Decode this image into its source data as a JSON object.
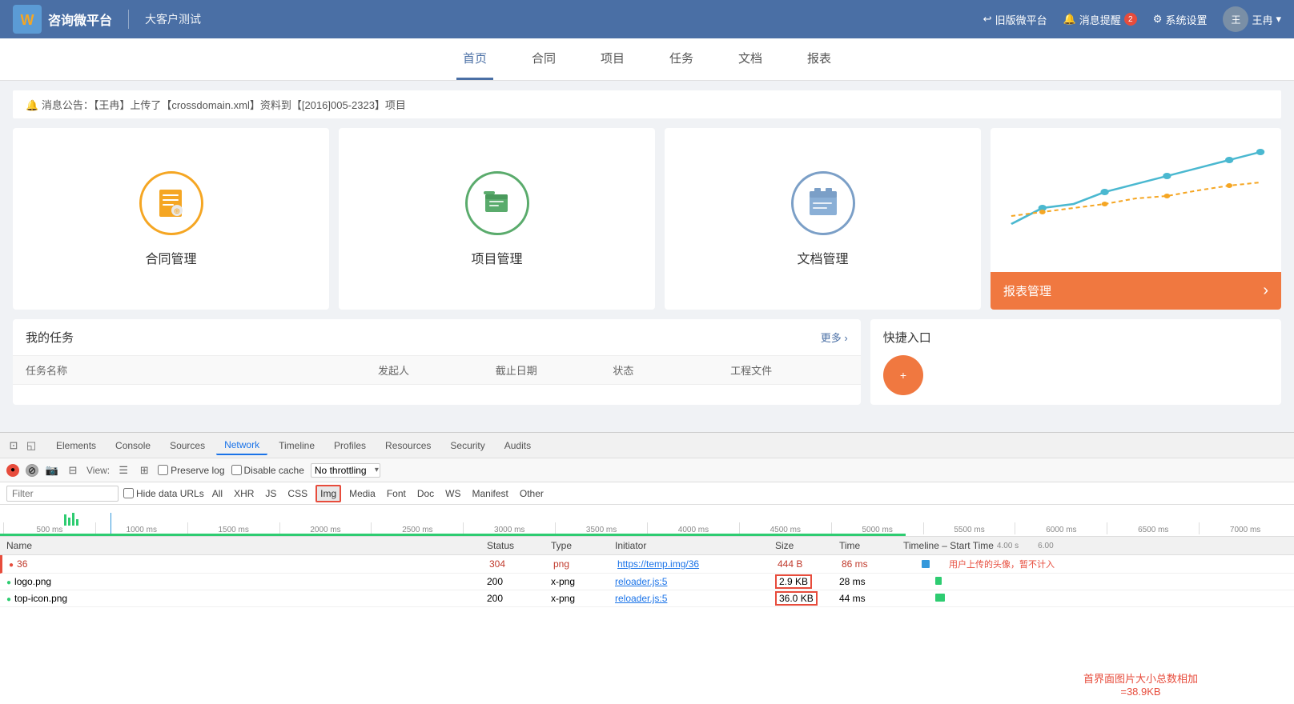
{
  "app": {
    "logo_text": "W",
    "title": "咨询微平台",
    "subtitle": "大客户测试"
  },
  "nav_right": {
    "old_version": "旧版微平台",
    "notifications": "消息提醒",
    "notification_count": "2",
    "settings": "系统设置",
    "username": "王冉",
    "dropdown": "▾"
  },
  "main_tabs": [
    {
      "label": "首页",
      "active": true
    },
    {
      "label": "合同",
      "active": false
    },
    {
      "label": "项目",
      "active": false
    },
    {
      "label": "任务",
      "active": false
    },
    {
      "label": "文档",
      "active": false
    },
    {
      "label": "报表",
      "active": false
    }
  ],
  "announcement": {
    "icon": "🔔",
    "text": "消息公告：【王冉】上传了【crossdomain.xml】资料到【[2016]005-2323】项目"
  },
  "cards": [
    {
      "id": "contract",
      "label": "合同管理",
      "icon_color": "#f5a623",
      "border_color": "#f5a623"
    },
    {
      "id": "project",
      "label": "项目管理",
      "icon_color": "#5aab6c",
      "border_color": "#5aab6c"
    },
    {
      "id": "document",
      "label": "文档管理",
      "icon_color": "#7b9fc7",
      "border_color": "#7b9fc7"
    }
  ],
  "report_card": {
    "button_label": "报表管理",
    "button_arrow": "›"
  },
  "my_tasks": {
    "title": "我的任务",
    "more": "更多 ›",
    "columns": [
      "任务名称",
      "发起人",
      "截止日期",
      "状态",
      "工程文件"
    ]
  },
  "quick_entry": {
    "title": "快捷入口"
  },
  "devtools": {
    "tabs": [
      "Elements",
      "Console",
      "Sources",
      "Network",
      "Timeline",
      "Profiles",
      "Resources",
      "Security",
      "Audits"
    ],
    "active_tab": "Network",
    "toolbar": {
      "view_icon": "☰",
      "preserve_log": "Preserve log",
      "disable_cache": "Disable cache",
      "no_throttling": "No throttling"
    },
    "filter": {
      "placeholder": "Filter",
      "hide_data_urls": "Hide data URLs",
      "types": [
        "All",
        "XHR",
        "JS",
        "CSS",
        "Img",
        "Media",
        "Font",
        "Doc",
        "WS",
        "Manifest",
        "Other"
      ],
      "active_type": "Img"
    },
    "timeline": {
      "ticks": [
        "500 ms",
        "1000 ms",
        "1500 ms",
        "2000 ms",
        "2500 ms",
        "3000 ms",
        "3500 ms",
        "4000 ms",
        "4500 ms",
        "5000 ms",
        "5500 ms",
        "6000 ms",
        "6500 ms",
        "7000 ms"
      ]
    },
    "table": {
      "headers": [
        "Name",
        "Status",
        "Type",
        "Initiator",
        "Size",
        "Time",
        "Timeline – Start Time"
      ],
      "rows": [
        {
          "name": "36",
          "status": "304",
          "type": "png",
          "initiator": "https://temp.img/36",
          "size": "444 B",
          "time": "86 ms",
          "is_error": true
        },
        {
          "name": "logo.png",
          "status": "200",
          "type": "x-png",
          "initiator": "reloader.js:5",
          "size": "2.9 KB",
          "time": "28 ms",
          "is_error": false,
          "size_highlight": true
        },
        {
          "name": "top-icon.png",
          "status": "200",
          "type": "x-png",
          "initiator": "reloader.js:5",
          "size": "36.0 KB",
          "time": "44 ms",
          "is_error": false,
          "size_highlight": true
        }
      ]
    },
    "annotations": {
      "avatar_note": "用户上传的头像，暂不计入",
      "sum_note_line1": "首界面图片大小总数相加",
      "sum_note_line2": "=38.9KB",
      "timeline_label": "4.00 s",
      "timeline_label2": "6.00"
    }
  }
}
